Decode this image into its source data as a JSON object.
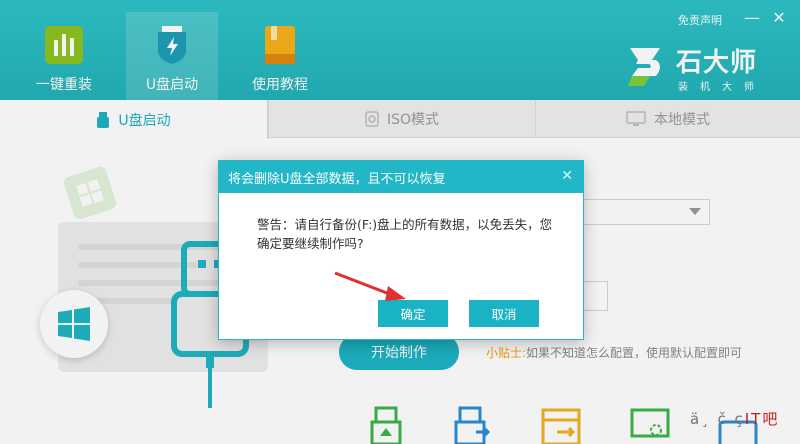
{
  "header": {
    "nav": [
      {
        "label": "一键重装",
        "icon": "bar-chart-icon"
      },
      {
        "label": "U盘启动",
        "icon": "usb-shield-icon"
      },
      {
        "label": "使用教程",
        "icon": "book-icon"
      }
    ],
    "disclaimer": "免责声明",
    "window_controls": {
      "minimize": "—",
      "close": "✕"
    },
    "brand": {
      "name": "石大师",
      "subtitle": "装机大师"
    }
  },
  "tabs": [
    {
      "label": "U盘启动",
      "icon": "usb-drive-icon",
      "active": true
    },
    {
      "label": "ISO模式",
      "icon": "iso-disc-icon",
      "active": false
    },
    {
      "label": "本地模式",
      "icon": "monitor-icon",
      "active": false
    }
  ],
  "main": {
    "start_button": "开始制作",
    "tip_label": "小贴士:",
    "tip_text": "如果不知道怎么配置，使用默认配置即可"
  },
  "dialog": {
    "title": "将会删除U盘全部数据，且不可以恢复",
    "close": "✕",
    "message": "警告：请自行备份(F:)盘上的所有数据，以免丢失，您确定要继续制作吗?",
    "confirm_label": "确定",
    "cancel_label": "取消"
  },
  "watermark": {
    "garbled": "ä¸ č ç",
    "suffix": "IT吧"
  },
  "colors": {
    "accent": "#1cb4c4",
    "header": "#2fc3c8",
    "tip": "#f0a018",
    "arrow": "#e03131"
  }
}
